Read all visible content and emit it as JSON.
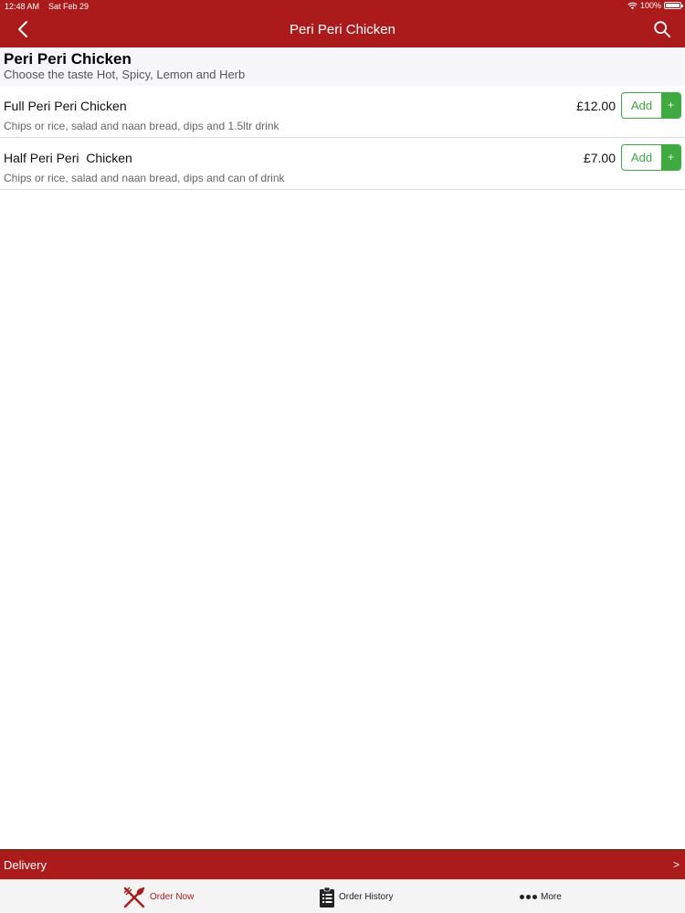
{
  "status_bar": {
    "time": "12:48 AM",
    "date": "Sat Feb 29",
    "battery": "100%",
    "battery_level": 1.0
  },
  "nav": {
    "title": "Peri Peri Chicken",
    "back_icon": "chevron-left-icon",
    "search_icon": "search-icon"
  },
  "category": {
    "title": "Peri Peri Chicken",
    "subtitle": "Choose the taste Hot, Spicy, Lemon and Herb"
  },
  "items": [
    {
      "name": "Full Peri Peri Chicken",
      "description": "Chips or rice, salad and naan bread, dips and 1.5ltr drink",
      "price": "£12.00",
      "add_label": "Add",
      "plus_label": "+"
    },
    {
      "name": "Half Peri Peri  Chicken",
      "description": "Chips or rice, salad and naan bread, dips and can of drink",
      "price": "£7.00",
      "add_label": "Add",
      "plus_label": "+"
    }
  ],
  "delivery": {
    "label": "Delivery",
    "arrow": ">"
  },
  "tabbar": {
    "tabs": [
      {
        "label": "Order Now",
        "icon": "fork-knife-icon",
        "active": true
      },
      {
        "label": "Order History",
        "icon": "clipboard-icon",
        "active": false
      },
      {
        "label": "More",
        "icon": "more-dots-icon",
        "active": false
      }
    ]
  },
  "colors": {
    "brand_red": "#ac1b1b",
    "add_green": "#3faa3f",
    "header_bg": "#f7f7f9"
  }
}
